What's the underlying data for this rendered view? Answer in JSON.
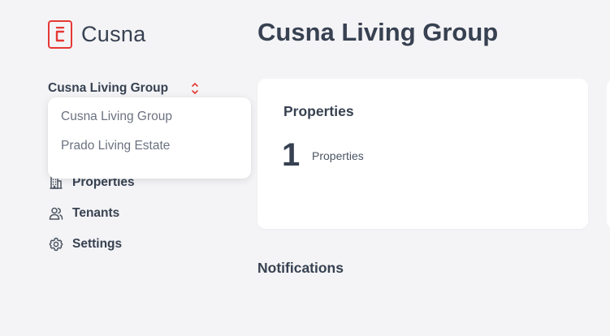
{
  "brand": {
    "name": "Cusna",
    "accent": "#e53935"
  },
  "org_selector": {
    "selected": "Cusna Living Group",
    "options": [
      "Cusna Living Group",
      "Prado Living Estate"
    ]
  },
  "nav": {
    "items": [
      {
        "label": "Properties",
        "icon": "building-icon"
      },
      {
        "label": "Tenants",
        "icon": "users-icon"
      },
      {
        "label": "Settings",
        "icon": "gear-icon"
      }
    ]
  },
  "main": {
    "title": "Cusna Living Group",
    "card": {
      "title": "Properties",
      "count": "1",
      "count_label": "Properties"
    },
    "notifications_title": "Notifications"
  }
}
